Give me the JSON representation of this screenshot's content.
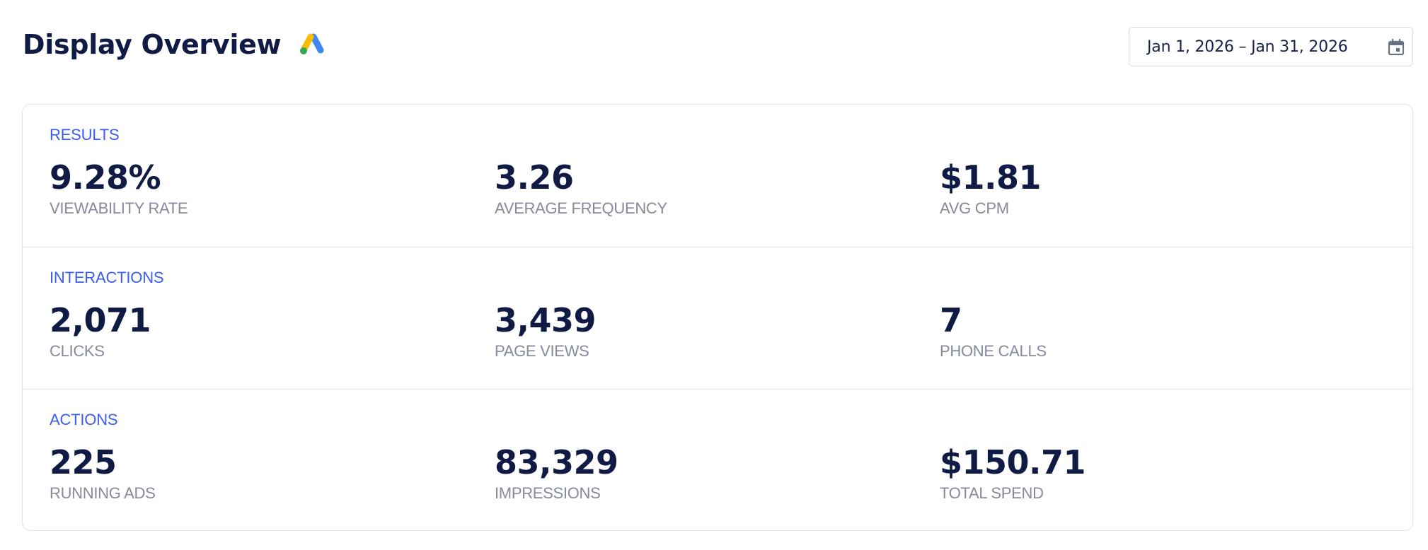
{
  "header": {
    "title": "Display Overview",
    "logo_icon": "google-ads-logo-icon",
    "date_range": "Jan 1, 2026 – Jan 31, 2026",
    "calendar_icon": "calendar-icon"
  },
  "colors": {
    "title": "#0f1a45",
    "section_heading": "#3b5cf0",
    "metric_label": "#858a9c",
    "border": "#dfe2e8",
    "logo_blue": "#4285f4",
    "logo_yellow": "#fbbc04",
    "logo_green": "#34a853"
  },
  "sections": [
    {
      "heading": "RESULTS",
      "metrics": [
        {
          "value": "9.28%",
          "label": "VIEWABILITY RATE"
        },
        {
          "value": "3.26",
          "label": "AVERAGE FREQUENCY"
        },
        {
          "value": "$1.81",
          "label": "AVG CPM"
        }
      ]
    },
    {
      "heading": "INTERACTIONS",
      "metrics": [
        {
          "value": "2,071",
          "label": "CLICKS"
        },
        {
          "value": "3,439",
          "label": "PAGE VIEWS"
        },
        {
          "value": "7",
          "label": "PHONE CALLS"
        }
      ]
    },
    {
      "heading": "ACTIONS",
      "metrics": [
        {
          "value": "225",
          "label": "RUNNING ADS"
        },
        {
          "value": "83,329",
          "label": "IMPRESSIONS"
        },
        {
          "value": "$150.71",
          "label": "TOTAL SPEND"
        }
      ]
    }
  ]
}
